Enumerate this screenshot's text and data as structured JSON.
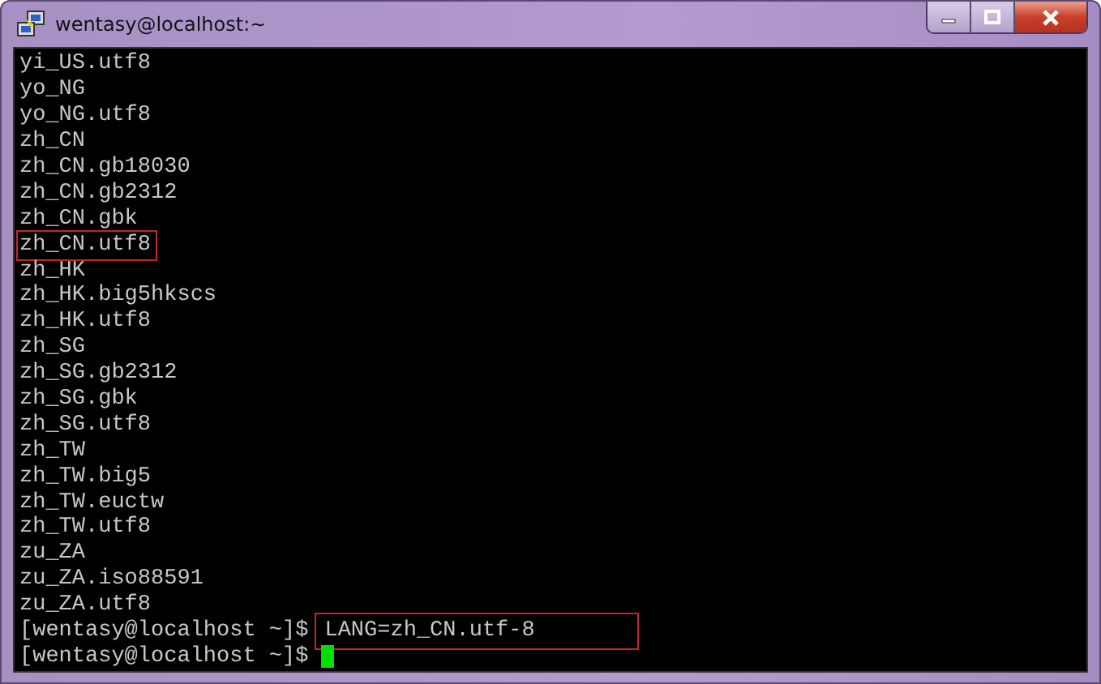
{
  "window": {
    "title": "wentasy@localhost:~"
  },
  "lines": [
    {
      "kind": "output",
      "text": "yi_US.utf8",
      "highlighted": false
    },
    {
      "kind": "output",
      "text": "yo_NG",
      "highlighted": false
    },
    {
      "kind": "output",
      "text": "yo_NG.utf8",
      "highlighted": false
    },
    {
      "kind": "output",
      "text": "zh_CN",
      "highlighted": false
    },
    {
      "kind": "output",
      "text": "zh_CN.gb18030",
      "highlighted": false
    },
    {
      "kind": "output",
      "text": "zh_CN.gb2312",
      "highlighted": false
    },
    {
      "kind": "output",
      "text": "zh_CN.gbk",
      "highlighted": false
    },
    {
      "kind": "output",
      "text": "zh_CN.utf8",
      "highlighted": true
    },
    {
      "kind": "output",
      "text": "zh_HK",
      "highlighted": false
    },
    {
      "kind": "output",
      "text": "zh_HK.big5hkscs",
      "highlighted": false
    },
    {
      "kind": "output",
      "text": "zh_HK.utf8",
      "highlighted": false
    },
    {
      "kind": "output",
      "text": "zh_SG",
      "highlighted": false
    },
    {
      "kind": "output",
      "text": "zh_SG.gb2312",
      "highlighted": false
    },
    {
      "kind": "output",
      "text": "zh_SG.gbk",
      "highlighted": false
    },
    {
      "kind": "output",
      "text": "zh_SG.utf8",
      "highlighted": false
    },
    {
      "kind": "output",
      "text": "zh_TW",
      "highlighted": false
    },
    {
      "kind": "output",
      "text": "zh_TW.big5",
      "highlighted": false
    },
    {
      "kind": "output",
      "text": "zh_TW.euctw",
      "highlighted": false
    },
    {
      "kind": "output",
      "text": "zh_TW.utf8",
      "highlighted": false
    },
    {
      "kind": "output",
      "text": "zu_ZA",
      "highlighted": false
    },
    {
      "kind": "output",
      "text": "zu_ZA.iso88591",
      "highlighted": false
    },
    {
      "kind": "output",
      "text": "zu_ZA.utf8",
      "highlighted": false
    },
    {
      "kind": "prompt",
      "prompt": "[wentasy@localhost ~]$",
      "command": "LANG=zh_CN.utf-8",
      "highlighted": true,
      "cursor": false
    },
    {
      "kind": "prompt",
      "prompt": "[wentasy@localhost ~]$",
      "cursor": true
    }
  ]
}
